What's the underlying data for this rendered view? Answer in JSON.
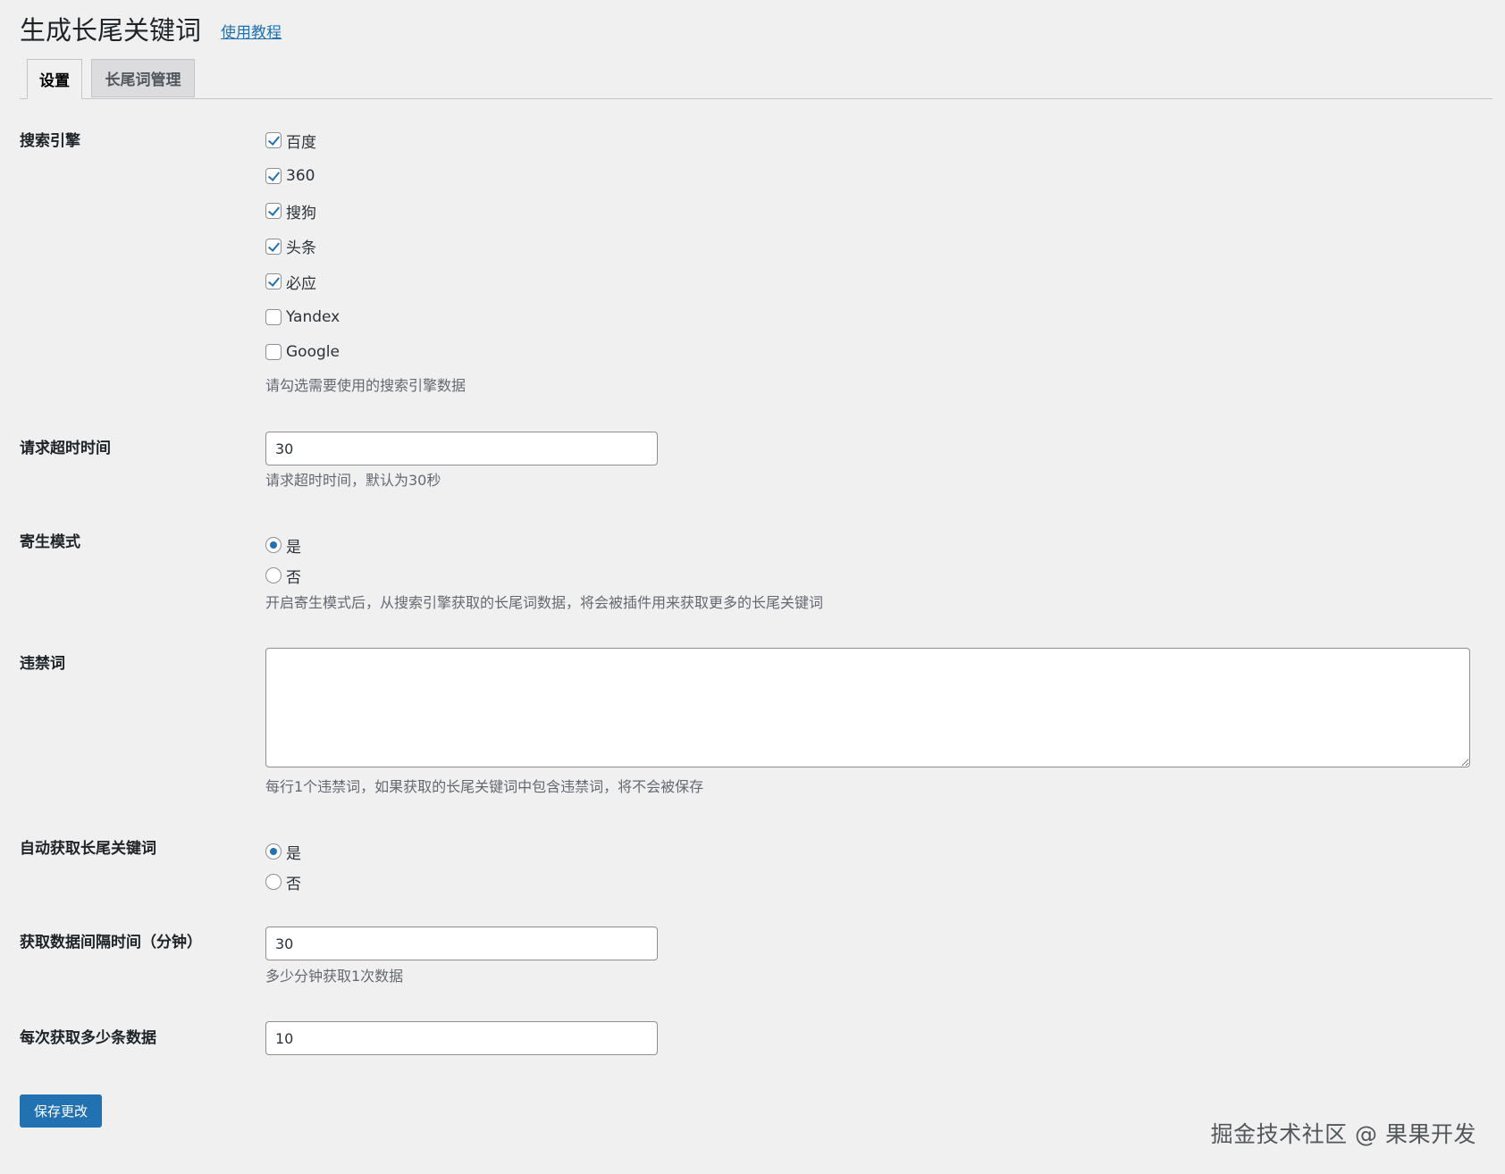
{
  "header": {
    "title": "生成长尾关键词",
    "tutorial_link": "使用教程"
  },
  "tabs": [
    {
      "label": "设置",
      "active": true
    },
    {
      "label": "长尾词管理",
      "active": false
    }
  ],
  "search_engines": {
    "label": "搜索引擎",
    "options": [
      {
        "label": "百度",
        "checked": true
      },
      {
        "label": "360",
        "checked": true
      },
      {
        "label": "搜狗",
        "checked": true
      },
      {
        "label": "头条",
        "checked": true
      },
      {
        "label": "必应",
        "checked": true
      },
      {
        "label": "Yandex",
        "checked": false
      },
      {
        "label": "Google",
        "checked": false
      }
    ],
    "description": "请勾选需要使用的搜索引擎数据"
  },
  "timeout": {
    "label": "请求超时时间",
    "value": "30",
    "description": "请求超时时间，默认为30秒"
  },
  "parasite_mode": {
    "label": "寄生模式",
    "options": [
      {
        "label": "是",
        "checked": true
      },
      {
        "label": "否",
        "checked": false
      }
    ],
    "description": "开启寄生模式后，从搜索引擎获取的长尾词数据，将会被插件用来获取更多的长尾关键词"
  },
  "banned_words": {
    "label": "违禁词",
    "value": "",
    "description": "每行1个违禁词，如果获取的长尾关键词中包含违禁词，将不会被保存"
  },
  "auto_fetch": {
    "label": "自动获取长尾关键词",
    "options": [
      {
        "label": "是",
        "checked": true
      },
      {
        "label": "否",
        "checked": false
      }
    ]
  },
  "interval": {
    "label": "获取数据间隔时间（分钟）",
    "value": "30",
    "description": "多少分钟获取1次数据"
  },
  "per_fetch": {
    "label": "每次获取多少条数据",
    "value": "10"
  },
  "save_button": "保存更改",
  "watermark": "掘金技术社区 @ 果果开发",
  "colors": {
    "accent": "#2271b1",
    "background": "#f0f0f1",
    "description_text": "#646970"
  }
}
